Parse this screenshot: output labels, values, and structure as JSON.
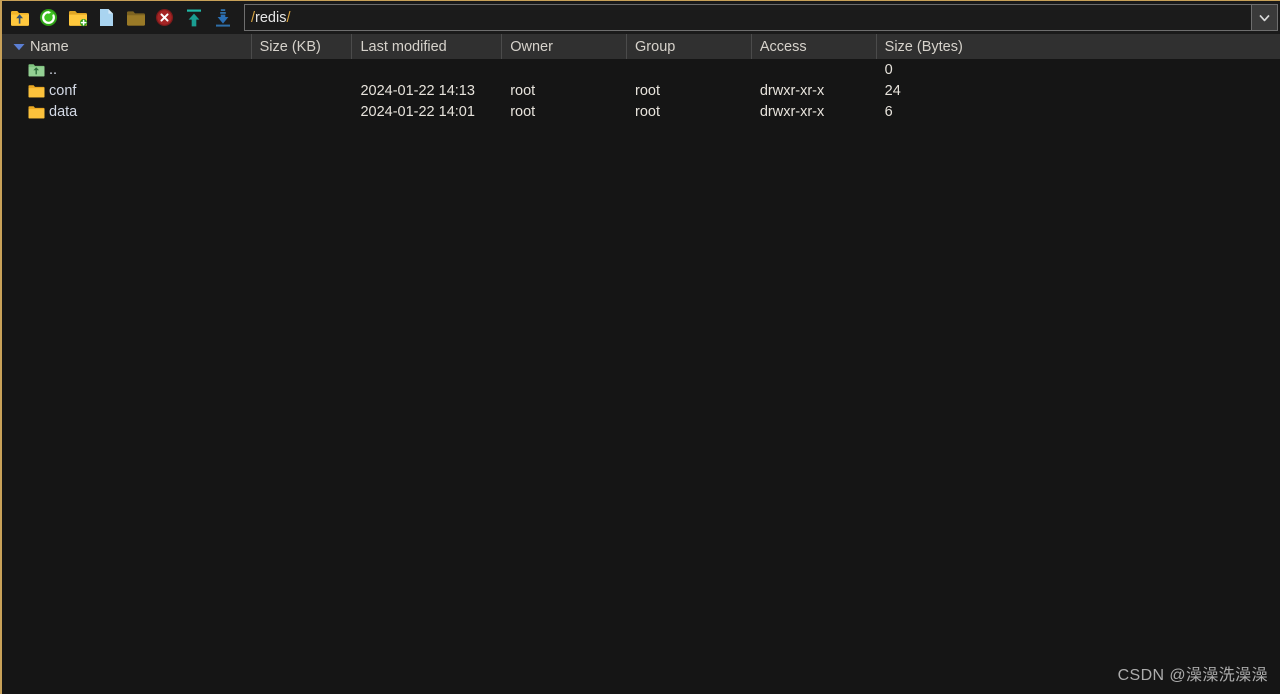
{
  "window": {
    "frame_accent": "#c8a158",
    "background": "#151515"
  },
  "toolbar": {
    "buttons": [
      {
        "name": "parent-directory-button",
        "icon": "folder-up-icon",
        "label": "Parent directory",
        "color": "#f0b429"
      },
      {
        "name": "refresh-button",
        "icon": "refresh-icon",
        "label": "Refresh",
        "color": "#3cb521"
      },
      {
        "name": "new-folder-button",
        "icon": "folder-add-icon",
        "label": "New folder",
        "color": "#f0b429"
      },
      {
        "name": "new-file-button",
        "icon": "file-new-icon",
        "label": "New file",
        "color": "#a6d3f2"
      },
      {
        "name": "open-folder-button",
        "icon": "folder-icon",
        "label": "Open folder",
        "color": "#8a6d1f"
      },
      {
        "name": "delete-button",
        "icon": "delete-circle-icon",
        "label": "Delete",
        "color": "#a52222"
      },
      {
        "name": "upload-button",
        "icon": "upload-arrow-icon",
        "label": "Upload",
        "color": "#1fb8a6"
      },
      {
        "name": "download-button",
        "icon": "download-arrow-icon",
        "label": "Download",
        "color": "#2a6fb5"
      }
    ]
  },
  "path": {
    "value": "/redis/",
    "placeholder": "/",
    "segments": [
      {
        "text": "/",
        "type": "sep"
      },
      {
        "text": "redis",
        "type": "name"
      },
      {
        "text": "/",
        "type": "sep"
      }
    ],
    "dropdown_icon": "chevron-down-icon"
  },
  "columns": [
    {
      "key": "name",
      "label": "Name",
      "sorted": true,
      "sort_icon": "sort-desc-triangle-icon"
    },
    {
      "key": "size_kb",
      "label": "Size (KB)",
      "sorted": false
    },
    {
      "key": "modified",
      "label": "Last modified",
      "sorted": false
    },
    {
      "key": "owner",
      "label": "Owner",
      "sorted": false
    },
    {
      "key": "group",
      "label": "Group",
      "sorted": false
    },
    {
      "key": "access",
      "label": "Access",
      "sorted": false
    },
    {
      "key": "size_b",
      "label": "Size (Bytes)",
      "sorted": false
    }
  ],
  "rows": [
    {
      "icon": "parent-folder-icon",
      "name": "..",
      "size_kb": "",
      "modified": "",
      "owner": "",
      "group": "",
      "access": "",
      "size_b": "0"
    },
    {
      "icon": "folder-icon",
      "name": "conf",
      "size_kb": "",
      "modified": "2024-01-22 14:13",
      "owner": "root",
      "group": "root",
      "access": "drwxr-xr-x",
      "size_b": "24"
    },
    {
      "icon": "folder-icon",
      "name": "data",
      "size_kb": "",
      "modified": "2024-01-22 14:01",
      "owner": "root",
      "group": "root",
      "access": "drwxr-xr-x",
      "size_b": "6"
    }
  ],
  "watermark": {
    "text": "CSDN @澡澡洗澡澡"
  }
}
